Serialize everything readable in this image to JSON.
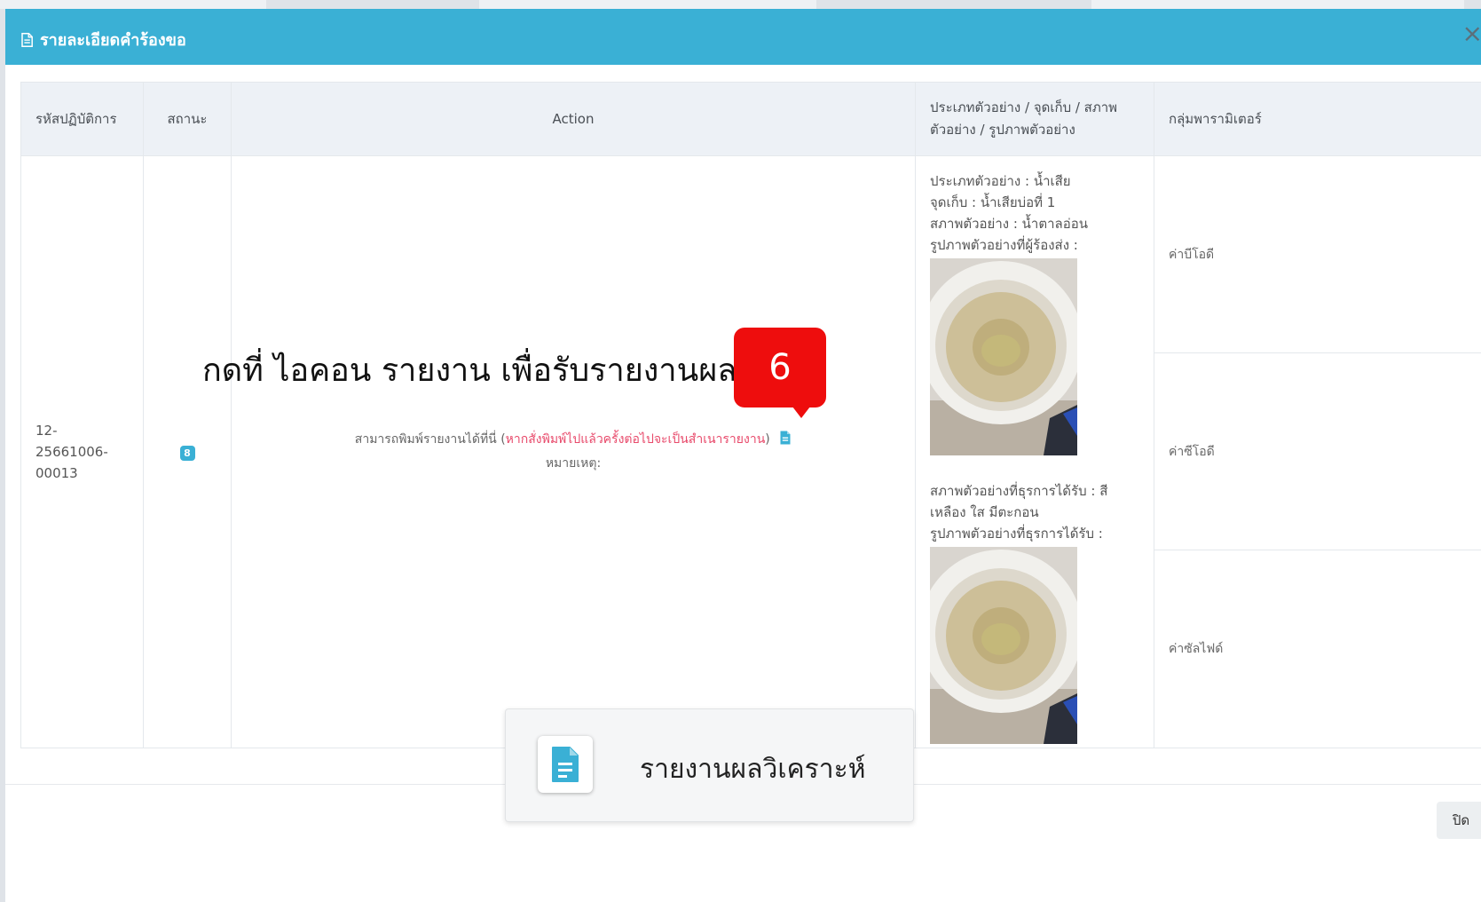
{
  "modal": {
    "title": "รายละเอียดคำร้องขอ",
    "close_symbol": "×",
    "close_button_label": "ปิด"
  },
  "table": {
    "headers": {
      "op_code": "รหัสปฏิบัติการ",
      "status": "สถานะ",
      "action": "Action",
      "sample_line1": "ประเภทตัวอย่าง / จุดเก็บ / สภาพ",
      "sample_line2": "ตัวอย่าง / รูปภาพตัวอย่าง",
      "param_group": "กลุ่มพารามิเตอร์"
    },
    "row": {
      "op_code": [
        "12-",
        "25661006-",
        "00013"
      ],
      "status_badge": "8",
      "action_print_text": "สามารถพิมพ์รายงานได้ที่นี่ (",
      "action_warning": "หากสั่งพิมพ์ไปแล้วครั้งต่อไปจะเป็นสำเนารายงาน",
      "action_close_paren": ")",
      "action_remark": "หมายเหตุ:",
      "sample": {
        "type_label": "ประเภทตัวอย่าง : ",
        "type_value": "น้ำเสีย",
        "point_label": "จุดเก็บ : ",
        "point_value": "น้ำเสียบ่อที่ 1",
        "cond_label": "สภาพตัวอย่าง : ",
        "cond_value": "น้ำตาลอ่อน",
        "img_sender_label": "รูปภาพตัวอย่างที่ผู้ร้องส่ง :",
        "received_cond_label": "สภาพตัวอย่างที่ธุรการได้รับ : ",
        "received_cond_value": "สีเหลือง ใส มีตะกอน",
        "img_received_label": "รูปภาพตัวอย่างที่ธุรการได้รับ :"
      },
      "params": [
        "ค่าบีโอดี",
        "ค่าซีโอดี",
        "ค่าซัลไฟด์"
      ]
    }
  },
  "overlay": {
    "instruction": "กดที่ ไอคอน รายงาน เพื่อรับรายงานผล",
    "step_number": "6",
    "legend_label": "รายงานผลวิเคราะห์"
  },
  "colors": {
    "header": "#3ab0d5",
    "warning": "#e84a6b",
    "step_badge": "#ee0d0d"
  },
  "icons": {
    "report": "document-icon",
    "sample_photo": "sample-photo"
  }
}
